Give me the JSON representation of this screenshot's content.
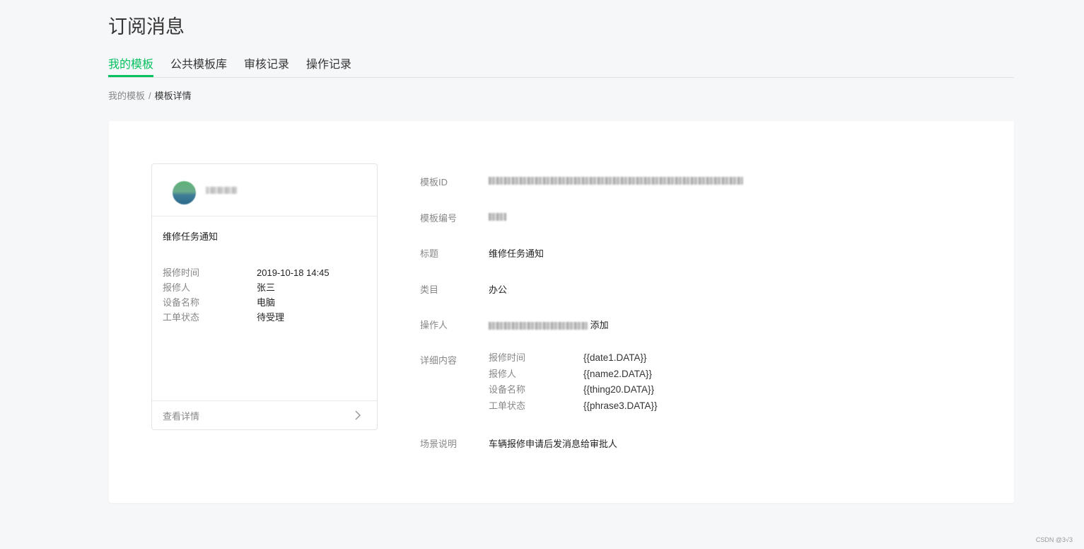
{
  "page": {
    "title": "订阅消息",
    "tabs": [
      "我的模板",
      "公共模板库",
      "审核记录",
      "操作记录"
    ],
    "active_tab": 0,
    "breadcrumb": {
      "parent": "我的模板",
      "separator": "/",
      "current": "模板详情"
    }
  },
  "preview": {
    "title": "维修任务通知",
    "fields": [
      {
        "label": "报修时间",
        "value": "2019-10-18 14:45"
      },
      {
        "label": "报修人",
        "value": "张三"
      },
      {
        "label": "设备名称",
        "value": "电脑"
      },
      {
        "label": "工单状态",
        "value": "待受理"
      }
    ],
    "footer_link": "查看详情",
    "footer_icon": "chevron-right-icon"
  },
  "details": {
    "template_id_label": "模板ID",
    "template_no_label": "模板编号",
    "title_label": "标题",
    "title_value": "维修任务通知",
    "category_label": "类目",
    "category_value": "办公",
    "operator_label": "操作人",
    "operator_suffix": "添加",
    "content_label": "详细内容",
    "content": [
      {
        "label": "报修时间",
        "value": "{{date1.DATA}}"
      },
      {
        "label": "报修人",
        "value": "{{name2.DATA}}"
      },
      {
        "label": "设备名称",
        "value": "{{thing20.DATA}}"
      },
      {
        "label": "工单状态",
        "value": "{{phrase3.DATA}}"
      }
    ],
    "scene_label": "场景说明",
    "scene_value": "车辆报修申请后发消息给审批人"
  },
  "watermark": "CSDN @3√3",
  "colors": {
    "accent": "#07c160",
    "background": "#f6f7f9",
    "muted": "#888888"
  }
}
